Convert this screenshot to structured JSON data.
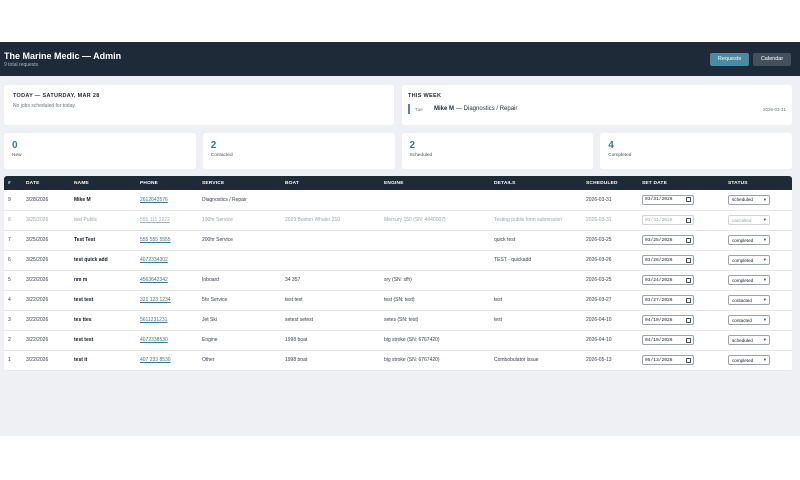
{
  "header": {
    "title": "The Marine Medic — Admin",
    "subtitle": "9 total requests",
    "requests_label": "Requests",
    "calendar_label": "Calendar"
  },
  "today": {
    "heading": "TODAY — SATURDAY, MAR 28",
    "empty": "No jobs scheduled for today."
  },
  "week": {
    "heading": "THIS WEEK",
    "items": [
      {
        "day": "Tue",
        "name": "Mike M",
        "service": "— Diagnostics / Repair",
        "date": "2026-03-31"
      }
    ]
  },
  "stats": [
    {
      "value": "0",
      "label": "New"
    },
    {
      "value": "2",
      "label": "Contacted"
    },
    {
      "value": "2",
      "label": "Scheduled"
    },
    {
      "value": "4",
      "label": "Completed"
    }
  ],
  "table": {
    "columns": [
      "#",
      "DATE",
      "NAME",
      "PHONE",
      "SERVICE",
      "BOAT",
      "ENGINE",
      "DETAILS",
      "SCHEDULED",
      "SET DATE",
      "STATUS"
    ],
    "rows": [
      {
        "id": "9",
        "date": "3/28/2026",
        "name": "Mike M",
        "phone": "2612643576",
        "service": "Diagnostics / Repair",
        "boat": "",
        "engine": "",
        "details": "",
        "scheduled": "2026-03-31",
        "set_date": "03/31/2026",
        "status": "scheduled",
        "cancelled": false
      },
      {
        "id": "8",
        "date": "3/25/2026",
        "name": "test Public",
        "phone": "555 111 2222",
        "service": "100hr Service",
        "boat": "2029 Boston Whaler 210",
        "engine": "Mercury 150 (SN: 4840007)",
        "details": "Testing public form submission",
        "scheduled": "2026-03-31",
        "set_date": "03/31/2026",
        "status": "cancelled",
        "cancelled": true
      },
      {
        "id": "7",
        "date": "3/25/2026",
        "name": "Test Test",
        "phone": "555 555 5555",
        "service": "200hr Service",
        "boat": "",
        "engine": "",
        "details": "quick test",
        "scheduled": "2026-03-25",
        "set_date": "03/25/2026",
        "status": "completed",
        "cancelled": false
      },
      {
        "id": "6",
        "date": "3/25/2026",
        "name": "test quick add",
        "phone": "4072334302",
        "service": "",
        "boat": "",
        "engine": "",
        "details": "TEST - quickadd",
        "scheduled": "2026-03-26",
        "set_date": "03/26/2026",
        "status": "completed",
        "cancelled": false
      },
      {
        "id": "5",
        "date": "3/22/2026",
        "name": "nm m",
        "phone": "4563642342",
        "service": "Inboard",
        "boat": "34 357",
        "engine": "sry (SN: sfh)",
        "details": "",
        "scheduled": "2026-03-25",
        "set_date": "03/24/2026",
        "status": "completed",
        "cancelled": false
      },
      {
        "id": "4",
        "date": "3/22/2026",
        "name": "test test",
        "phone": "321 123 1234",
        "service": "5hr Service",
        "boat": "test test",
        "engine": "test (SN: test)",
        "details": "test",
        "scheduled": "2026-03-27",
        "set_date": "03/27/2026",
        "status": "contacted",
        "cancelled": false
      },
      {
        "id": "3",
        "date": "3/22/2026",
        "name": "tes ttes",
        "phone": "5611231231",
        "service": "Jet Ski",
        "boat": "setest setest",
        "engine": "setes (SN: test)",
        "details": "test",
        "scheduled": "2026-04-10",
        "set_date": "04/10/2026",
        "status": "contacted",
        "cancelled": false
      },
      {
        "id": "2",
        "date": "3/22/2026",
        "name": "test test",
        "phone": "4072338530",
        "service": "Engine",
        "boat": "1998 boat",
        "engine": "big stroke (SN: 6767420)",
        "details": "",
        "scheduled": "2026-04-10",
        "set_date": "04/10/2026",
        "status": "scheduled",
        "cancelled": false
      },
      {
        "id": "1",
        "date": "3/22/2026",
        "name": "test it",
        "phone": "407 233 8530",
        "service": "Other",
        "boat": "1998 boat",
        "engine": "big stroke (SN: 6767420)",
        "details": "Combobulator issue",
        "scheduled": "2026-05-13",
        "set_date": "05/13/2026",
        "status": "completed",
        "cancelled": false
      }
    ]
  },
  "icons": {
    "calendar": "calendar-icon",
    "dropdown": "chevron-down-icon"
  },
  "colors": {
    "header_bg": "#1e2a38",
    "accent": "#4a8aa3",
    "stat_value": "#3b7890",
    "calendar_button": "#44505e"
  }
}
